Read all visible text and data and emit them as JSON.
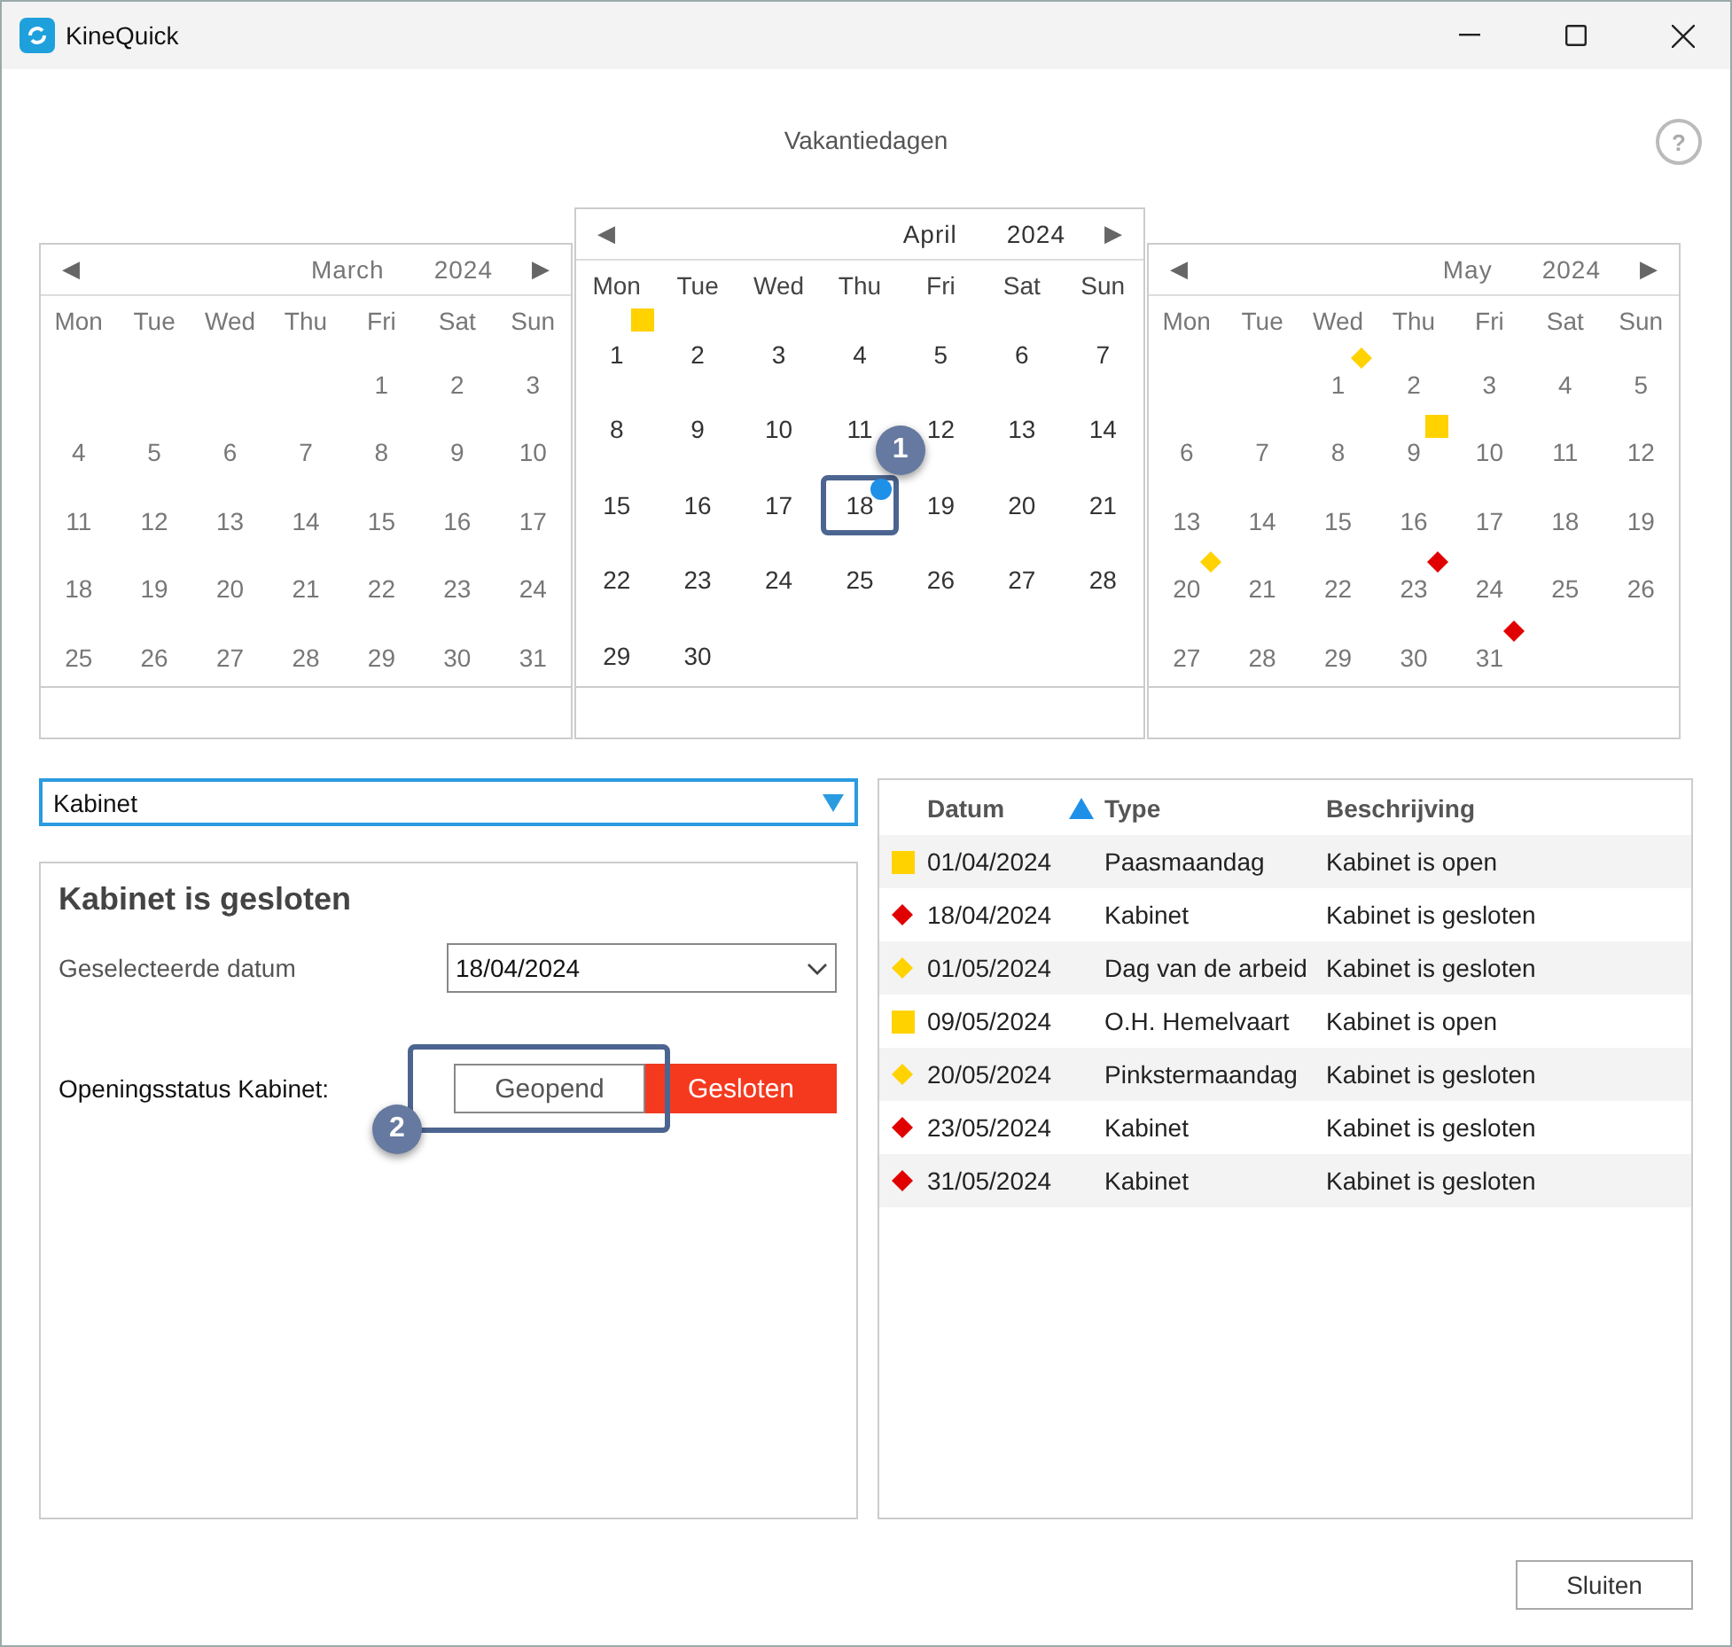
{
  "window": {
    "title": "KineQuick"
  },
  "page_title": "Vakantiedagen",
  "help_button": "?",
  "calendars": [
    {
      "prev": "◀",
      "month": "March",
      "year": "2024",
      "next": "▶",
      "focused": false,
      "weekdays": [
        "Mon",
        "Tue",
        "Wed",
        "Thu",
        "Fri",
        "Sat",
        "Sun"
      ],
      "weeks": [
        {
          "kind": "first",
          "days": [
            {
              "day": "1",
              "selected": false
            },
            {
              "day": "2",
              "selected": false
            },
            {
              "day": "3",
              "selected": false
            }
          ]
        },
        {
          "kind": "middle",
          "days": [
            {
              "day": "4",
              "selected": false
            },
            {
              "day": "5",
              "selected": false
            },
            {
              "day": "6",
              "selected": false
            },
            {
              "day": "7",
              "selected": false
            },
            {
              "day": "8",
              "selected": false
            },
            {
              "day": "9",
              "selected": false
            },
            {
              "day": "10",
              "selected": false
            }
          ]
        },
        {
          "kind": "middle",
          "days": [
            {
              "day": "11",
              "selected": false
            },
            {
              "day": "12",
              "selected": false
            },
            {
              "day": "13",
              "selected": false
            },
            {
              "day": "14",
              "selected": false
            },
            {
              "day": "15",
              "selected": false
            },
            {
              "day": "16",
              "selected": false
            },
            {
              "day": "17",
              "selected": false
            }
          ]
        },
        {
          "kind": "middle",
          "days": [
            {
              "day": "18",
              "selected": false
            },
            {
              "day": "19",
              "selected": false
            },
            {
              "day": "20",
              "selected": false
            },
            {
              "day": "21",
              "selected": false
            },
            {
              "day": "22",
              "selected": false
            },
            {
              "day": "23",
              "selected": false
            },
            {
              "day": "24",
              "selected": false
            }
          ]
        },
        {
          "kind": "last",
          "days": [
            {
              "day": "25",
              "selected": false
            },
            {
              "day": "26",
              "selected": false
            },
            {
              "day": "27",
              "selected": false
            },
            {
              "day": "28",
              "selected": false
            },
            {
              "day": "29",
              "selected": false
            },
            {
              "day": "30",
              "selected": false
            },
            {
              "day": "31",
              "selected": false
            }
          ]
        }
      ]
    },
    {
      "prev": "◀",
      "month": "April",
      "year": "2024",
      "next": "▶",
      "focused": true,
      "weekdays": [
        "Mon",
        "Tue",
        "Wed",
        "Thu",
        "Fri",
        "Sat",
        "Sun"
      ],
      "weeks": [
        {
          "kind": "first",
          "days": [
            {
              "day": "1",
              "selected": false,
              "marker": {
                "kind": "square",
                "color": "#ffd200"
              }
            },
            {
              "day": "2",
              "selected": false
            },
            {
              "day": "3",
              "selected": false
            },
            {
              "day": "4",
              "selected": false
            },
            {
              "day": "5",
              "selected": false
            },
            {
              "day": "6",
              "selected": false
            },
            {
              "day": "7",
              "selected": false
            }
          ]
        },
        {
          "kind": "middle",
          "days": [
            {
              "day": "8",
              "selected": false
            },
            {
              "day": "9",
              "selected": false
            },
            {
              "day": "10",
              "selected": false
            },
            {
              "day": "11",
              "selected": false
            },
            {
              "day": "12",
              "selected": false
            },
            {
              "day": "13",
              "selected": false
            },
            {
              "day": "14",
              "selected": false
            }
          ]
        },
        {
          "kind": "middle",
          "days": [
            {
              "day": "15",
              "selected": false
            },
            {
              "day": "16",
              "selected": false
            },
            {
              "day": "17",
              "selected": false
            },
            {
              "day": "18",
              "selected": true,
              "callout": "1",
              "marker": {
                "kind": "dot",
                "color": "#1e90e8"
              }
            },
            {
              "day": "19",
              "selected": false
            },
            {
              "day": "20",
              "selected": false
            },
            {
              "day": "21",
              "selected": false
            }
          ]
        },
        {
          "kind": "middle",
          "days": [
            {
              "day": "22",
              "selected": false
            },
            {
              "day": "23",
              "selected": false
            },
            {
              "day": "24",
              "selected": false
            },
            {
              "day": "25",
              "selected": false
            },
            {
              "day": "26",
              "selected": false
            },
            {
              "day": "27",
              "selected": false
            },
            {
              "day": "28",
              "selected": false
            }
          ]
        },
        {
          "kind": "last",
          "days": [
            {
              "day": "29",
              "selected": false
            },
            {
              "day": "30",
              "selected": false
            }
          ]
        }
      ]
    },
    {
      "prev": "◀",
      "month": "May",
      "year": "2024",
      "next": "▶",
      "focused": false,
      "weekdays": [
        "Mon",
        "Tue",
        "Wed",
        "Thu",
        "Fri",
        "Sat",
        "Sun"
      ],
      "weeks": [
        {
          "kind": "first",
          "days": [
            {
              "day": "1",
              "selected": false,
              "marker": {
                "kind": "diamond",
                "color": "#ffd200"
              }
            },
            {
              "day": "2",
              "selected": false
            },
            {
              "day": "3",
              "selected": false
            },
            {
              "day": "4",
              "selected": false
            },
            {
              "day": "5",
              "selected": false
            }
          ]
        },
        {
          "kind": "middle",
          "days": [
            {
              "day": "6",
              "selected": false
            },
            {
              "day": "7",
              "selected": false
            },
            {
              "day": "8",
              "selected": false
            },
            {
              "day": "9",
              "selected": false,
              "marker": {
                "kind": "square",
                "color": "#ffd200"
              }
            },
            {
              "day": "10",
              "selected": false
            },
            {
              "day": "11",
              "selected": false
            },
            {
              "day": "12",
              "selected": false
            }
          ]
        },
        {
          "kind": "middle",
          "days": [
            {
              "day": "13",
              "selected": false
            },
            {
              "day": "14",
              "selected": false
            },
            {
              "day": "15",
              "selected": false
            },
            {
              "day": "16",
              "selected": false
            },
            {
              "day": "17",
              "selected": false
            },
            {
              "day": "18",
              "selected": false
            },
            {
              "day": "19",
              "selected": false
            }
          ]
        },
        {
          "kind": "middle",
          "days": [
            {
              "day": "20",
              "selected": false,
              "marker": {
                "kind": "diamond",
                "color": "#ffd200"
              }
            },
            {
              "day": "21",
              "selected": false
            },
            {
              "day": "22",
              "selected": false
            },
            {
              "day": "23",
              "selected": false,
              "marker": {
                "kind": "diamond",
                "color": "#e00000"
              }
            },
            {
              "day": "24",
              "selected": false
            },
            {
              "day": "25",
              "selected": false
            },
            {
              "day": "26",
              "selected": false
            }
          ]
        },
        {
          "kind": "last",
          "days": [
            {
              "day": "27",
              "selected": false
            },
            {
              "day": "28",
              "selected": false
            },
            {
              "day": "29",
              "selected": false
            },
            {
              "day": "30",
              "selected": false
            },
            {
              "day": "31",
              "selected": false,
              "marker": {
                "kind": "diamond",
                "color": "#e00000"
              }
            }
          ]
        }
      ]
    }
  ],
  "category_dropdown": {
    "value": "Kabinet"
  },
  "detail": {
    "heading": "Kabinet is gesloten",
    "date_label": "Geselecteerde datum",
    "date_value": "18/04/2024",
    "status_label": "Openingsstatus Kabinet:",
    "status_callout": "2",
    "status_options": [
      {
        "label": "Geopend",
        "selected": false
      },
      {
        "label": "Gesloten",
        "selected": true
      }
    ]
  },
  "table": {
    "columns": [
      "Datum",
      "Type",
      "Beschrijving"
    ],
    "rows": [
      {
        "marker": {
          "kind": "square",
          "color": "#ffd200"
        },
        "datum": "01/04/2024",
        "type": "Paasmaandag",
        "beschrijving": "Kabinet is open"
      },
      {
        "marker": {
          "kind": "diamond",
          "color": "#e00000"
        },
        "datum": "18/04/2024",
        "type": "Kabinet",
        "beschrijving": "Kabinet is gesloten"
      },
      {
        "marker": {
          "kind": "diamond",
          "color": "#ffd200"
        },
        "datum": "01/05/2024",
        "type": "Dag van de arbeid",
        "beschrijving": "Kabinet is gesloten"
      },
      {
        "marker": {
          "kind": "square",
          "color": "#ffd200"
        },
        "datum": "09/05/2024",
        "type": "O.H. Hemelvaart",
        "beschrijving": "Kabinet is open"
      },
      {
        "marker": {
          "kind": "diamond",
          "color": "#ffd200"
        },
        "datum": "20/05/2024",
        "type": "Pinkstermaandag",
        "beschrijving": "Kabinet is gesloten"
      },
      {
        "marker": {
          "kind": "diamond",
          "color": "#e00000"
        },
        "datum": "23/05/2024",
        "type": "Kabinet",
        "beschrijving": "Kabinet is gesloten"
      },
      {
        "marker": {
          "kind": "diamond",
          "color": "#e00000"
        },
        "datum": "31/05/2024",
        "type": "Kabinet",
        "beschrijving": "Kabinet is gesloten"
      }
    ]
  },
  "close_button": "Sluiten"
}
